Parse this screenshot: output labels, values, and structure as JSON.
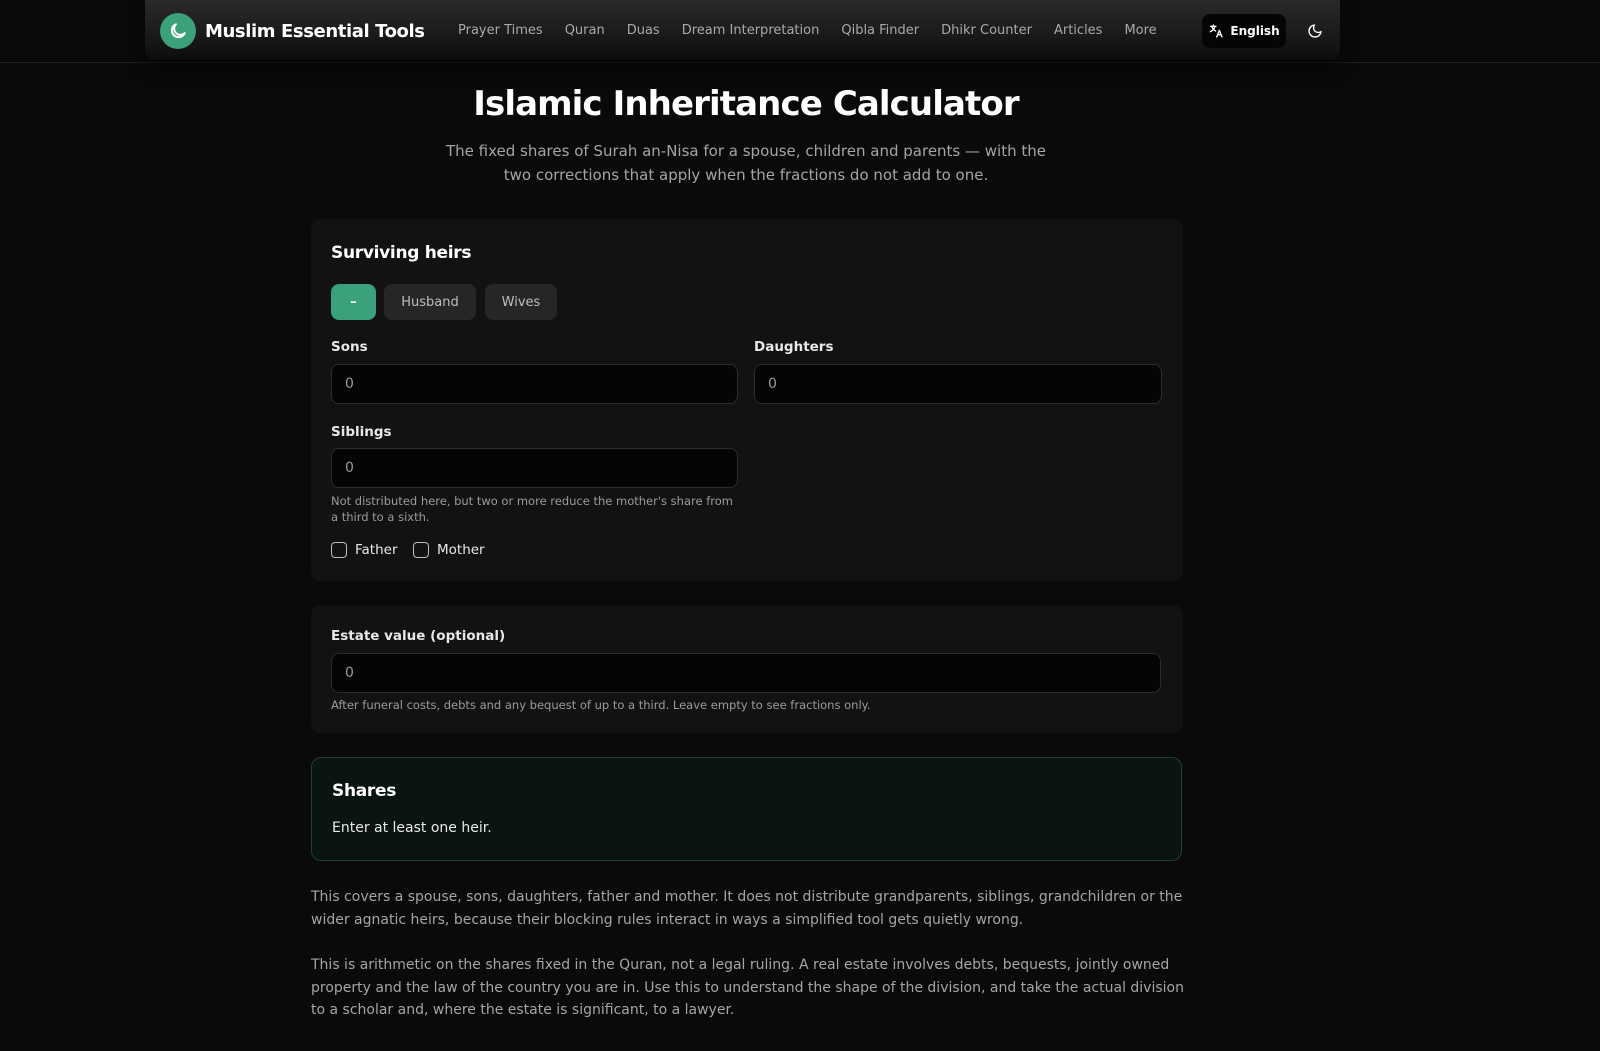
{
  "header": {
    "brand_name": "Muslim Essential Tools",
    "nav": [
      "Prayer Times",
      "Quran",
      "Duas",
      "Dream Interpretation",
      "Qibla Finder",
      "Dhikr Counter",
      "Articles",
      "More"
    ],
    "language_label": "English",
    "accent_color": "#3aa17a"
  },
  "hero": {
    "title": "Islamic Inheritance Calculator",
    "subtitle": "The fixed shares of Surah an-Nisa for a spouse, children and parents — with the two corrections that apply when the fractions do not add to one."
  },
  "heirs": {
    "title": "Surviving heirs",
    "spouse_options": [
      "–",
      "Husband",
      "Wives"
    ],
    "spouse_selected": "–",
    "sons_label": "Sons",
    "sons_value": "0",
    "daughters_label": "Daughters",
    "daughters_value": "0",
    "siblings_label": "Siblings",
    "siblings_value": "0",
    "siblings_help": "Not distributed here, but two or more reduce the mother's share from a third to a sixth.",
    "father_label": "Father",
    "mother_label": "Mother"
  },
  "estate": {
    "label": "Estate value (optional)",
    "value": "0",
    "help": "After funeral costs, debts and any bequest of up to a third. Leave empty to see fractions only."
  },
  "shares": {
    "title": "Shares",
    "message": "Enter at least one heir."
  },
  "notes": [
    "This covers a spouse, sons, daughters, father and mother. It does not distribute grandparents, siblings, grandchildren or the wider agnatic heirs, because their blocking rules interact in ways a simplified tool gets quietly wrong.",
    "This is arithmetic on the shares fixed in the Quran, not a legal ruling. A real estate involves debts, bequests, jointly owned property and the law of the country you are in. Use this to understand the shape of the division, and take the actual division to a scholar and, where the estate is significant, to a lawyer."
  ]
}
